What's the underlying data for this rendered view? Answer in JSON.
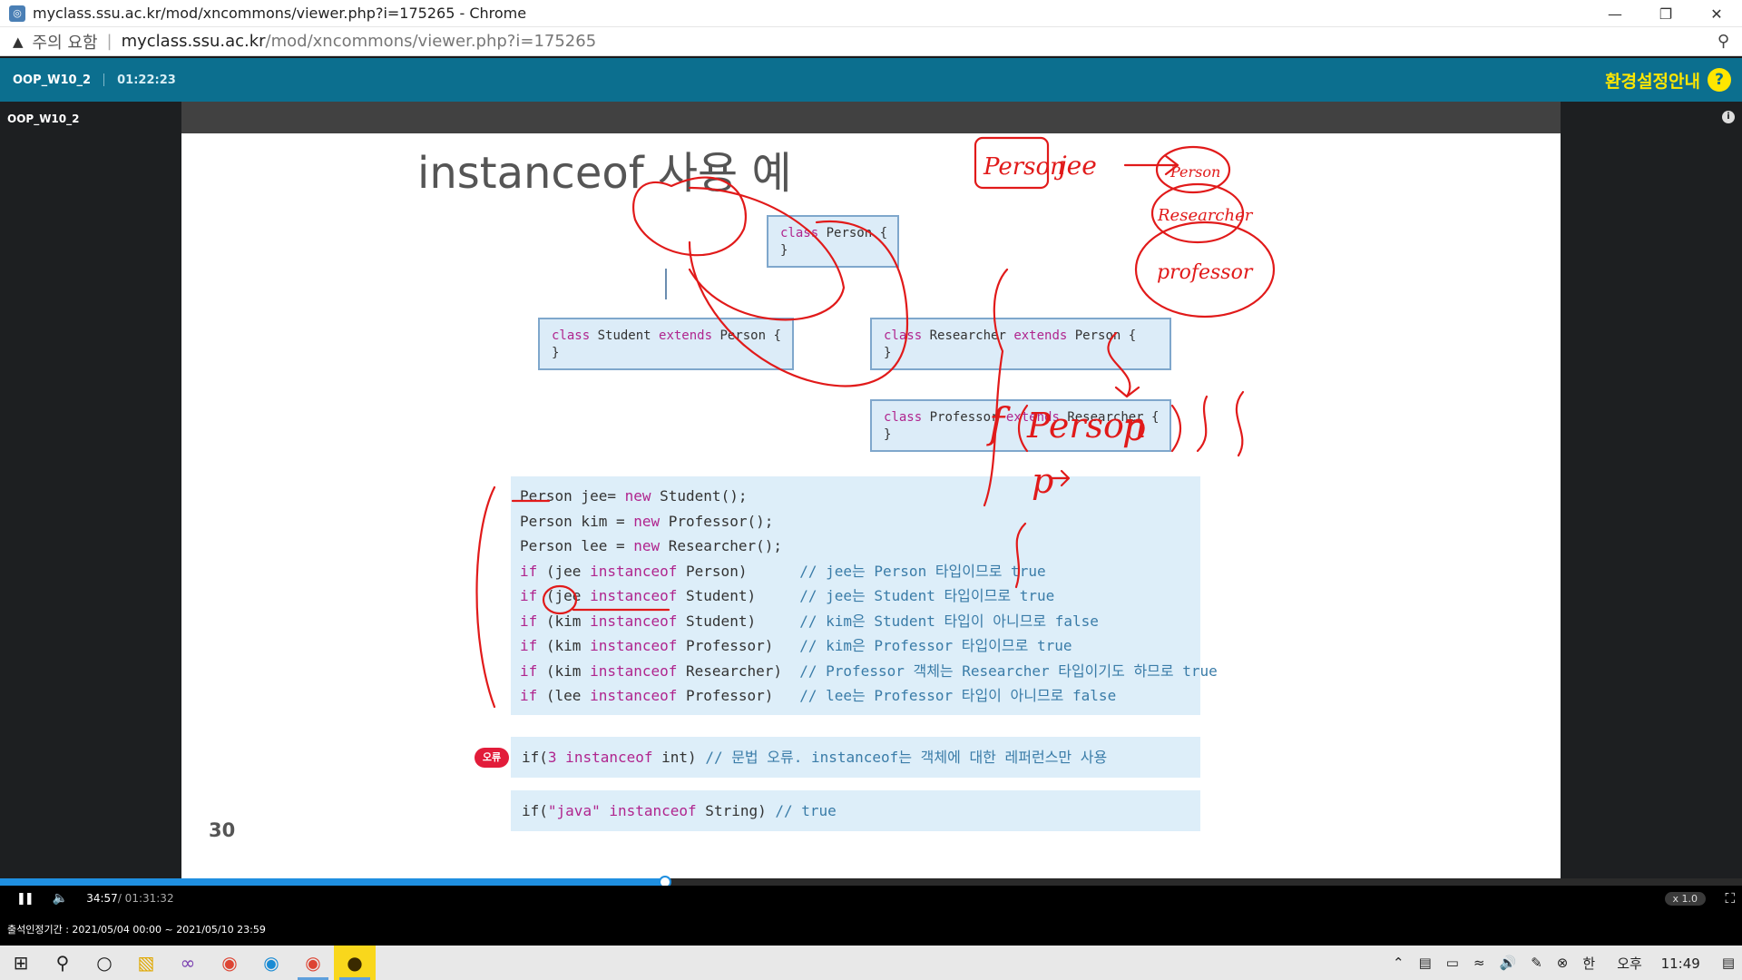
{
  "browser": {
    "window_title": "myclass.ssu.ac.kr/mod/xncommons/viewer.php?i=175265 - Chrome",
    "security_label": "주의 요함",
    "url_host": "myclass.ssu.ac.kr",
    "url_path": "/mod/xncommons/viewer.php?i=175265"
  },
  "player": {
    "lecture_title": "OOP_W10_2",
    "elapsed": "01:22:23",
    "guide_label": "환경설정안내",
    "help_label": "?",
    "side_title": "OOP_W10_2",
    "current_time": "34:57",
    "total_time": " / 01:31:32",
    "progress_fraction": 0.382,
    "speed": "x 1.0",
    "attendance": "출석인정기간 : 2021/05/04 00:00 ~ 2021/05/10 23:59"
  },
  "slide": {
    "title": "instanceof 사용 예",
    "page_number": "30",
    "hierarchy": {
      "person": {
        "kw": "class",
        "rest": " Person {",
        "close": "}"
      },
      "student": {
        "kw": "class",
        "name": " Student ",
        "ext": "extends",
        "rest": " Person {",
        "close": "}"
      },
      "researcher": {
        "kw": "class",
        "name": " Researcher ",
        "ext": "extends",
        "rest": " Person {",
        "close": "}"
      },
      "professor": {
        "kw": "class",
        "name": " Professor ",
        "ext": "extends",
        "rest": " Researcher {",
        "close": "}"
      }
    },
    "code_lines": [
      {
        "a": "Person jee= ",
        "kw1": "new",
        "b": " Student();",
        "kw2": "",
        "c": "",
        "cmt": ""
      },
      {
        "a": "Person kim = ",
        "kw1": "new",
        "b": " Professor();",
        "kw2": "",
        "c": "",
        "cmt": ""
      },
      {
        "a": "Person lee = ",
        "kw1": "new",
        "b": " Researcher();",
        "kw2": "",
        "c": "",
        "cmt": ""
      },
      {
        "a": "",
        "kw1": "if",
        "b": " (jee ",
        "kw2": "instanceof",
        "c": " Person)      ",
        "cmt": "// jee는 Person 타입이므로 true"
      },
      {
        "a": "",
        "kw1": "if",
        "b": " (jee ",
        "kw2": "instanceof",
        "c": " Student)     ",
        "cmt": "// jee는 Student 타입이므로 true"
      },
      {
        "a": "",
        "kw1": "if",
        "b": " (kim ",
        "kw2": "instanceof",
        "c": " Student)     ",
        "cmt": "// kim은 Student 타입이 아니므로 false"
      },
      {
        "a": "",
        "kw1": "if",
        "b": " (kim ",
        "kw2": "instanceof",
        "c": " Professor)   ",
        "cmt": "// kim은 Professor 타입이므로 true"
      },
      {
        "a": "",
        "kw1": "if",
        "b": " (kim ",
        "kw2": "instanceof",
        "c": " Researcher)  ",
        "cmt": "// Professor 객체는 Researcher 타입이기도 하므로 true"
      },
      {
        "a": "",
        "kw1": "if",
        "b": " (lee ",
        "kw2": "instanceof",
        "c": " Professor)   ",
        "cmt": "// lee는 Professor 타입이 아니므로 false"
      }
    ],
    "error_badge": "오류",
    "error_line": {
      "a": "if(",
      "num": "3",
      "kw": " instanceof",
      "b": " int) ",
      "cmt": "// 문법 오류. instanceof는 객체에 대한 레퍼런스만 사용"
    },
    "ok_line": {
      "a": "if(",
      "str": "\"java\"",
      "kw": " instanceof",
      "b": " String) ",
      "cmt": "// true"
    },
    "handwriting": {
      "person": "Person",
      "jee": "jee",
      "bubble_person": "Person",
      "bubble_researcher": "Researcher",
      "bubble_professor": "professor",
      "func_f": "f",
      "func_person": "Person",
      "func_p": "p",
      "p_arrow": "p"
    }
  },
  "taskbar": {
    "tray_ime": "한",
    "tray_ampm": "오후",
    "tray_time": "11:49"
  },
  "colors": {
    "header": "#0c6f8f",
    "guide": "#ffe600",
    "keyword": "#b0258e",
    "comment": "#3a7ca8",
    "ink": "#e11a1a",
    "progress": "#1f8fe0"
  }
}
